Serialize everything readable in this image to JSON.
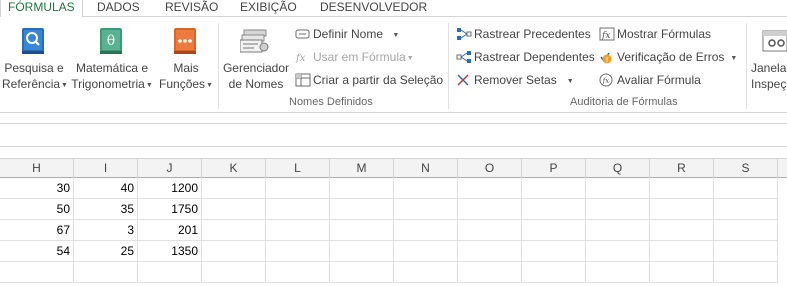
{
  "tabs": [
    {
      "label": "FÓRMULAS",
      "active": true
    },
    {
      "label": "DADOS"
    },
    {
      "label": "REVISÃO"
    },
    {
      "label": "EXIBIÇÃO"
    },
    {
      "label": "DESENVOLVEDOR"
    }
  ],
  "ribbon": {
    "function_library": {
      "lookup": {
        "line1": "Pesquisa e",
        "line2": "Referência",
        "icon": "book-magnifier-icon"
      },
      "math": {
        "line1": "Matemática e",
        "line2": "Trigonometria",
        "icon": "theta-book-icon"
      },
      "more": {
        "line1": "Mais",
        "line2": "Funções",
        "icon": "more-functions-book-icon"
      }
    },
    "defined_names": {
      "manager": {
        "line1": "Gerenciador",
        "line2": "de Nomes",
        "icon": "name-manager-icon"
      },
      "define_name": "Definir Nome",
      "use_in_formula": "Usar em Fórmula",
      "create_from_selection": "Criar a partir da Seleção",
      "group_label": "Nomes Definidos"
    },
    "formula_auditing": {
      "trace_precedents": "Rastrear Precedentes",
      "trace_dependents": "Rastrear Dependentes",
      "remove_arrows": "Remover Setas",
      "show_formulas": "Mostrar Fórmulas",
      "error_checking": "Verificação de Erros",
      "evaluate_formula": "Avaliar Fórmula",
      "group_label": "Auditoria de Fórmulas"
    },
    "watch_window": {
      "line1": "Janela",
      "line2": "Inspeç",
      "icon": "watch-window-icon"
    }
  },
  "columns": [
    "H",
    "I",
    "J",
    "K",
    "L",
    "M",
    "N",
    "O",
    "P",
    "Q",
    "R",
    "S"
  ],
  "rows": [
    [
      "30",
      "40",
      "1200"
    ],
    [
      "50",
      "35",
      "1750"
    ],
    [
      "67",
      "3",
      "201"
    ],
    [
      "54",
      "25",
      "1350"
    ]
  ],
  "colors": {
    "accent": "#217346",
    "header_bg": "#f3f3f3",
    "gridline": "#e0e0e0"
  }
}
